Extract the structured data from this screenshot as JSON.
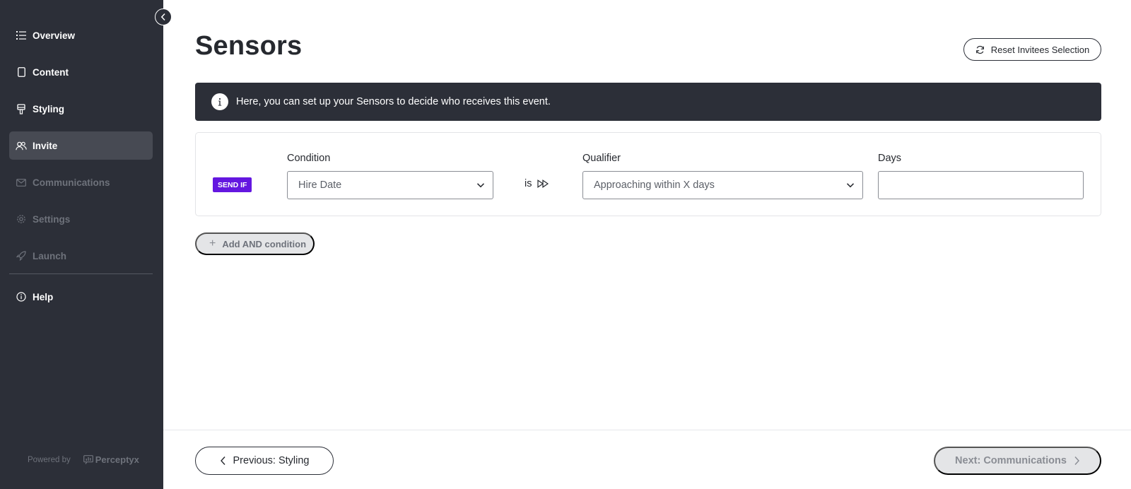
{
  "sidebar": {
    "items": [
      {
        "label": "Overview",
        "icon": "list-icon",
        "state": "normal"
      },
      {
        "label": "Content",
        "icon": "document-icon",
        "state": "normal"
      },
      {
        "label": "Styling",
        "icon": "brush-icon",
        "state": "normal"
      },
      {
        "label": "Invite",
        "icon": "users-icon",
        "state": "active"
      },
      {
        "label": "Communications",
        "icon": "mail-icon",
        "state": "disabled"
      },
      {
        "label": "Settings",
        "icon": "gear-icon",
        "state": "disabled"
      },
      {
        "label": "Launch",
        "icon": "rocket-icon",
        "state": "disabled"
      }
    ],
    "help": {
      "label": "Help",
      "icon": "info-icon"
    },
    "powered_by": "Powered by",
    "brand": "Perceptyx"
  },
  "header": {
    "title": "Sensors",
    "reset_button": "Reset Invitees Selection"
  },
  "banner": {
    "text": "Here, you can set up your Sensors to decide who receives this event."
  },
  "condition_row": {
    "badge": "SEND IF",
    "condition_label": "Condition",
    "condition_value": "Hire Date",
    "operator": "is",
    "qualifier_label": "Qualifier",
    "qualifier_value": "Approaching within X days",
    "days_label": "Days",
    "days_value": ""
  },
  "add_condition": "Add AND condition",
  "footer": {
    "prev_label": "Previous: Styling",
    "next_label": "Next: Communications"
  },
  "colors": {
    "sidebar_bg": "#2c2f38",
    "accent_badge": "#6417e0",
    "active_item": "#474a53"
  }
}
